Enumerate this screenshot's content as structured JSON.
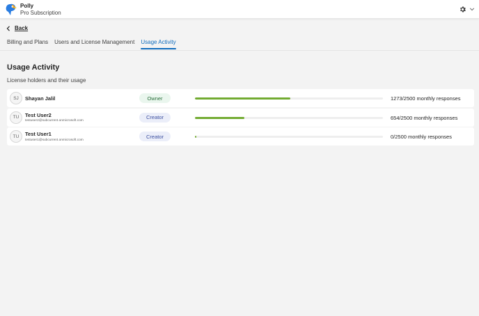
{
  "header": {
    "app_name": "Polly",
    "subscription": "Pro Subscription"
  },
  "nav": {
    "back_label": "Back",
    "tabs": [
      {
        "label": "Billing and Plans",
        "active": false
      },
      {
        "label": "Users and License Management",
        "active": false
      },
      {
        "label": "Usage Activity",
        "active": true
      }
    ]
  },
  "main": {
    "title": "Usage Activity",
    "subtitle": "License holders and their usage",
    "rows": [
      {
        "initials": "SJ",
        "name": "Shayan Jalil",
        "email": "",
        "role": "Owner",
        "used": 1273,
        "limit": 2500,
        "usage_text": "1273/2500 monthly responses"
      },
      {
        "initials": "TU",
        "name": "Test User2",
        "email": "testuser2@subcurrent.onmicrosoft.com",
        "role": "Creator",
        "used": 654,
        "limit": 2500,
        "usage_text": "654/2500 monthly responses"
      },
      {
        "initials": "TU",
        "name": "Test User1",
        "email": "testuser1@subcurrent.onmicrosoft.com",
        "role": "Creator",
        "used": 0,
        "limit": 2500,
        "usage_text": "0/2500 monthly responses"
      }
    ]
  },
  "colors": {
    "accent": "#0f6cbd",
    "progress": "#72ab31",
    "background": "#f3f3f3"
  },
  "icons": [
    "polly-logo-icon",
    "gear-icon",
    "chevron-down-icon",
    "chevron-left-icon"
  ]
}
